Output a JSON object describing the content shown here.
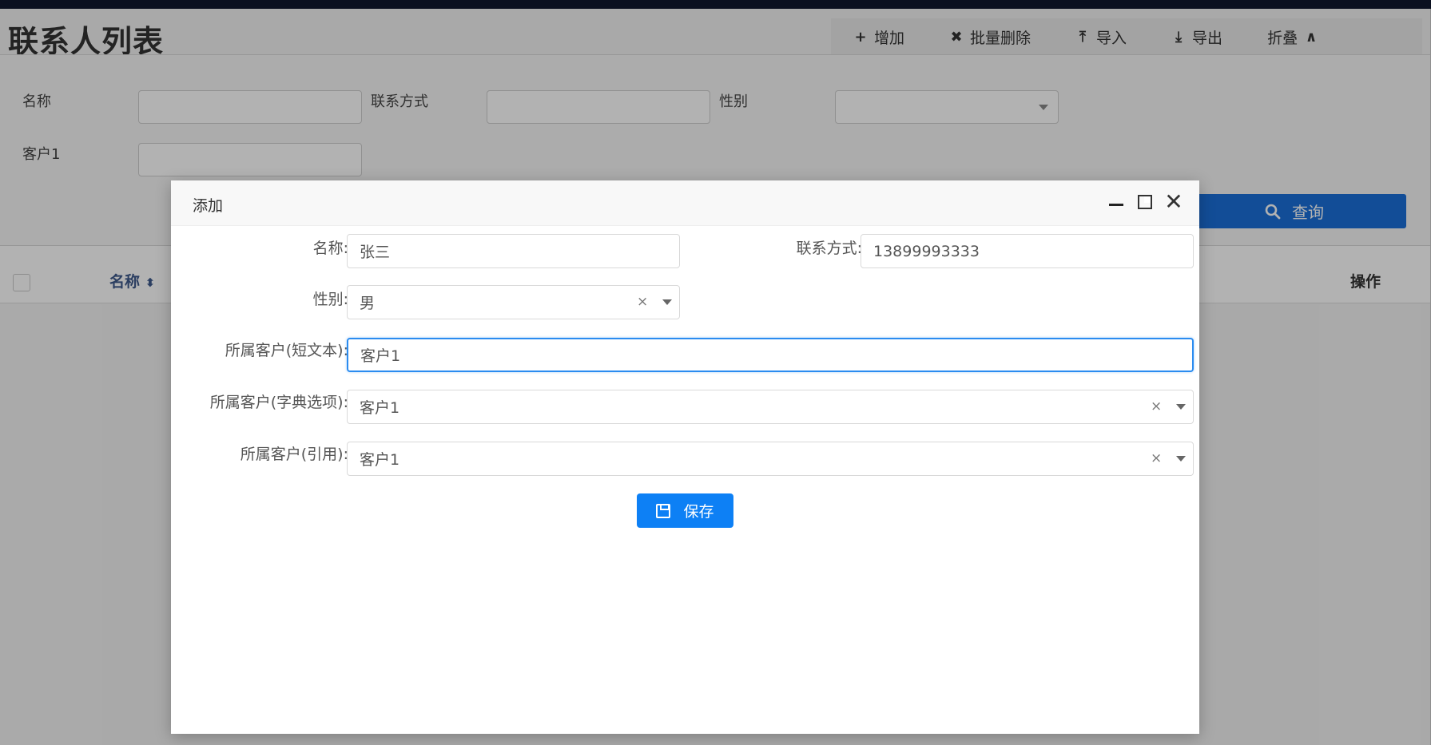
{
  "page": {
    "title": "联系人列表"
  },
  "toolbar": {
    "items": [
      {
        "icon": "plus-icon",
        "glyph": "+",
        "label": "增加"
      },
      {
        "icon": "close-icon",
        "glyph": "✖",
        "label": "批量删除"
      },
      {
        "icon": "upload-icon",
        "glyph": "⤒",
        "label": "导入"
      },
      {
        "icon": "download-icon",
        "glyph": "⤓",
        "label": "导出"
      },
      {
        "icon": "chevron-up-icon",
        "glyph": "∧",
        "label": "折叠"
      }
    ]
  },
  "search": {
    "name_label": "名称",
    "contact_label": "联系方式",
    "gender_label": "性别",
    "customer_label": "客户1",
    "query_label": "查询"
  },
  "table": {
    "col_name": "名称",
    "col_sort_glyph": "⬍",
    "col_actions": "操作"
  },
  "modal": {
    "title": "添加",
    "name_label": "名称:",
    "name_value": "张三",
    "contact_label": "联系方式:",
    "contact_value": "13899993333",
    "gender_label": "性别:",
    "gender_value": "男",
    "cust_short_label": "所属客户(短文本):",
    "cust_short_value": "客户1",
    "cust_dict_label": "所属客户(字典选项):",
    "cust_dict_value": "客户1",
    "cust_ref_label": "所属客户(引用):",
    "cust_ref_value": "客户1",
    "clear_glyph": "×",
    "close_glyph": "✕",
    "save_label": "保存"
  },
  "colors": {
    "primary": "#0d80f5",
    "query": "#1a6fd8",
    "focus_border": "#2b8cf0",
    "top_bar": "#10182e"
  }
}
